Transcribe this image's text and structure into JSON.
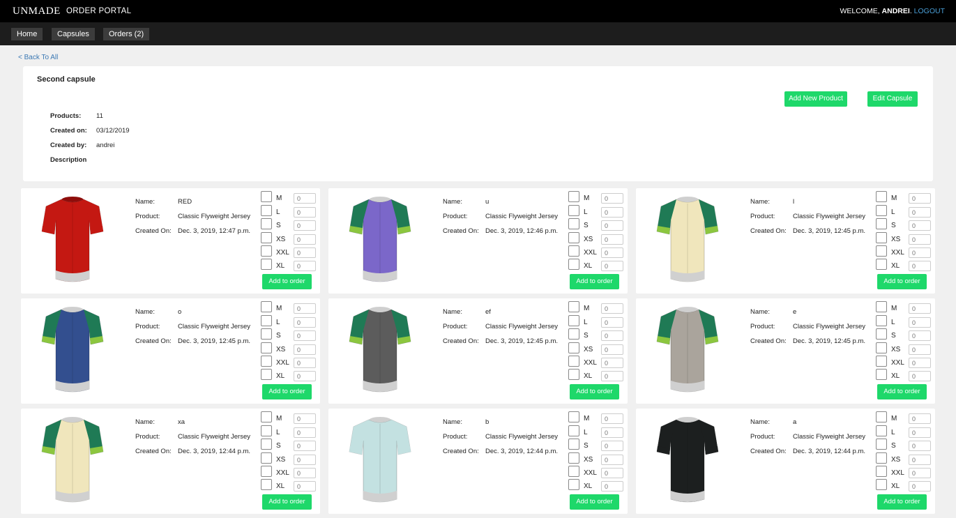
{
  "header": {
    "brand": "UNMADE",
    "portal": "ORDER PORTAL",
    "welcome_prefix": "WELCOME, ",
    "user": "ANDREI",
    "logout": "LOGOUT"
  },
  "nav": {
    "items": [
      {
        "label": "Home"
      },
      {
        "label": "Capsules"
      },
      {
        "label": "Orders (2)"
      }
    ]
  },
  "back_link": "< Back To All",
  "capsule": {
    "title": "Second capsule",
    "products_label": "Products:",
    "products_value": "11",
    "created_on_label": "Created on:",
    "created_on_value": "03/12/2019",
    "created_by_label": "Created by:",
    "created_by_value": "andrei",
    "description_label": "Description",
    "add_product_label": "Add New Product",
    "edit_capsule_label": "Edit Capsule"
  },
  "labels": {
    "name": "Name:",
    "product": "Product:",
    "created_on": "Created On:",
    "add_to_order": "Add to order",
    "qty_placeholder": "0"
  },
  "sizes": [
    "M",
    "L",
    "S",
    "XS",
    "XXL",
    "XL"
  ],
  "colors": {
    "accent": "#1ed86a",
    "link": "#3b78b3"
  },
  "products": [
    {
      "name": "RED",
      "product": "Classic Flyweight Jersey",
      "created": "Dec. 3, 2019, 12:47 p.m.",
      "body": "#c41812",
      "sleeve": "#c41812",
      "band": "#c41812",
      "collar": "#8e0d0b"
    },
    {
      "name": "u",
      "product": "Classic Flyweight Jersey",
      "created": "Dec. 3, 2019, 12:46 p.m.",
      "body": "#7b67c9",
      "sleeve": "#1f7a55",
      "band": "#8cc63f",
      "collar": "#cfcfcf"
    },
    {
      "name": "l",
      "product": "Classic Flyweight Jersey",
      "created": "Dec. 3, 2019, 12:45 p.m.",
      "body": "#f0e6bc",
      "sleeve": "#1f7a55",
      "band": "#8cc63f",
      "collar": "#cfcfcf"
    },
    {
      "name": "o",
      "product": "Classic Flyweight Jersey",
      "created": "Dec. 3, 2019, 12:45 p.m.",
      "body": "#334f8f",
      "sleeve": "#1f7a55",
      "band": "#8cc63f",
      "collar": "#cfcfcf"
    },
    {
      "name": "ef",
      "product": "Classic Flyweight Jersey",
      "created": "Dec. 3, 2019, 12:45 p.m.",
      "body": "#5c5c5c",
      "sleeve": "#1f7a55",
      "band": "#8cc63f",
      "collar": "#cfcfcf"
    },
    {
      "name": "e",
      "product": "Classic Flyweight Jersey",
      "created": "Dec. 3, 2019, 12:45 p.m.",
      "body": "#aaa49c",
      "sleeve": "#1f7a55",
      "band": "#8cc63f",
      "collar": "#cfcfcf"
    },
    {
      "name": "xa",
      "product": "Classic Flyweight Jersey",
      "created": "Dec. 3, 2019, 12:44 p.m.",
      "body": "#f0e6bc",
      "sleeve": "#1f7a55",
      "band": "#8cc63f",
      "collar": "#cfcfcf"
    },
    {
      "name": "b",
      "product": "Classic Flyweight Jersey",
      "created": "Dec. 3, 2019, 12:44 p.m.",
      "body": "#c3e1e1",
      "sleeve": "#c3e1e1",
      "band": "#c3e1e1",
      "collar": "#cfcfcf"
    },
    {
      "name": "a",
      "product": "Classic Flyweight Jersey",
      "created": "Dec. 3, 2019, 12:44 p.m.",
      "body": "#1c1f1f",
      "sleeve": "#1c1f1f",
      "band": "#1c1f1f",
      "collar": "#cfcfcf"
    }
  ]
}
